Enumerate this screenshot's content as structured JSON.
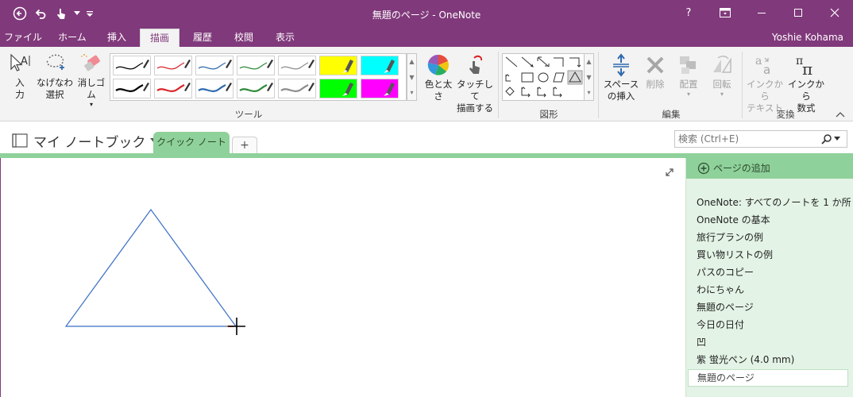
{
  "window": {
    "title": "無題のページ - OneNote"
  },
  "titlebar": {
    "icons": [
      "back-icon",
      "undo-icon",
      "touch-mode-icon",
      "chevron-down-icon",
      "customize-qat-icon"
    ],
    "help_label": "?",
    "controls": [
      "ribbon-display-icon",
      "minimize-icon",
      "maximize-icon",
      "close-icon"
    ]
  },
  "ribbon_tabs": [
    {
      "label": "ファイル"
    },
    {
      "label": "ホーム"
    },
    {
      "label": "挿入"
    },
    {
      "label": "描画",
      "active": true
    },
    {
      "label": "履歴"
    },
    {
      "label": "校閲"
    },
    {
      "label": "表示"
    }
  ],
  "user": {
    "name": "Yoshie Kohama"
  },
  "ribbon": {
    "tools": {
      "input_label": "入\n力",
      "lasso_label": "なげなわ\n選択",
      "eraser_label": "消しゴム",
      "group_label": "ツール",
      "pens": [
        {
          "color": "#000000",
          "style": "thin"
        },
        {
          "color": "#d9262a",
          "style": "thin"
        },
        {
          "color": "#2f6ab0",
          "style": "thin"
        },
        {
          "color": "#2e8b3a",
          "style": "thin"
        },
        {
          "color": "#8c8c8c",
          "style": "thin"
        },
        {
          "color": "#ffff00",
          "style": "highlighter"
        },
        {
          "color": "#00ffff",
          "style": "highlighter"
        },
        {
          "color": "#000000",
          "style": "thick"
        },
        {
          "color": "#d9262a",
          "style": "thick"
        },
        {
          "color": "#2f6ab0",
          "style": "thick"
        },
        {
          "color": "#2e8b3a",
          "style": "thick"
        },
        {
          "color": "#8c8c8c",
          "style": "thick"
        },
        {
          "color": "#00ff00",
          "style": "highlighter"
        },
        {
          "color": "#ff00ff",
          "style": "highlighter"
        }
      ],
      "color_thickness_label": "色と太さ",
      "touch_draw_label": "タッチして\n描画する"
    },
    "shapes": {
      "group_label": "図形"
    },
    "edit": {
      "insert_space_label": "スペース\nの挿入",
      "delete_label": "削除",
      "arrange_label": "配置",
      "rotate_label": "回転",
      "group_label": "編集"
    },
    "convert": {
      "ink_to_text_label": "インクから\nテキスト",
      "ink_to_math_label": "インクから\n数式",
      "group_label": "変換"
    }
  },
  "notebook": {
    "name": "マイ ノートブック"
  },
  "section_tabs": [
    {
      "label": "クイック ノート"
    }
  ],
  "add_section_label": "+",
  "search": {
    "placeholder": "検索 (Ctrl+E)"
  },
  "pagelist": {
    "add_page_label": "ページの追加",
    "items": [
      "OneNote: すべてのノートを 1 か所",
      "OneNote の基本",
      "旅行プランの例",
      "買い物リストの例",
      "パスのコピー",
      "わにちゃん",
      "無題のページ",
      "今日の日付",
      "凹",
      "紫 蛍光ペン (4.0 mm)"
    ],
    "selected_item": "無題のページ"
  },
  "canvas": {
    "stroke_color": "#3a6fc4"
  }
}
